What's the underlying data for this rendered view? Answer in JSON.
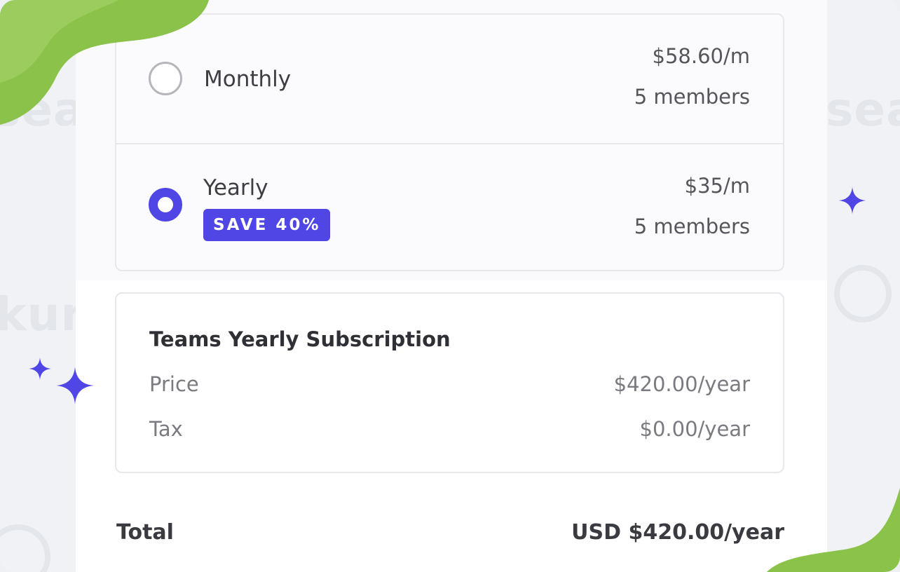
{
  "plans": [
    {
      "name": "Monthly",
      "price": "$58.60/m",
      "members": "5 members",
      "selected": false
    },
    {
      "name": "Yearly",
      "badge": "SAVE 40%",
      "price": "$35/m",
      "members": "5 members",
      "selected": true
    }
  ],
  "summary": {
    "title": "Teams Yearly Subscription",
    "price_label": "Price",
    "price_value": "$420.00/year",
    "tax_label": "Tax",
    "tax_value": "$0.00/year"
  },
  "total": {
    "label": "Total",
    "value": "USD $420.00/year"
  },
  "colors": {
    "accent": "#4f46e5",
    "green": "#8bc34a",
    "border": "#e7e8ec"
  },
  "icons": {
    "sparkle": "sparkle-icon"
  }
}
